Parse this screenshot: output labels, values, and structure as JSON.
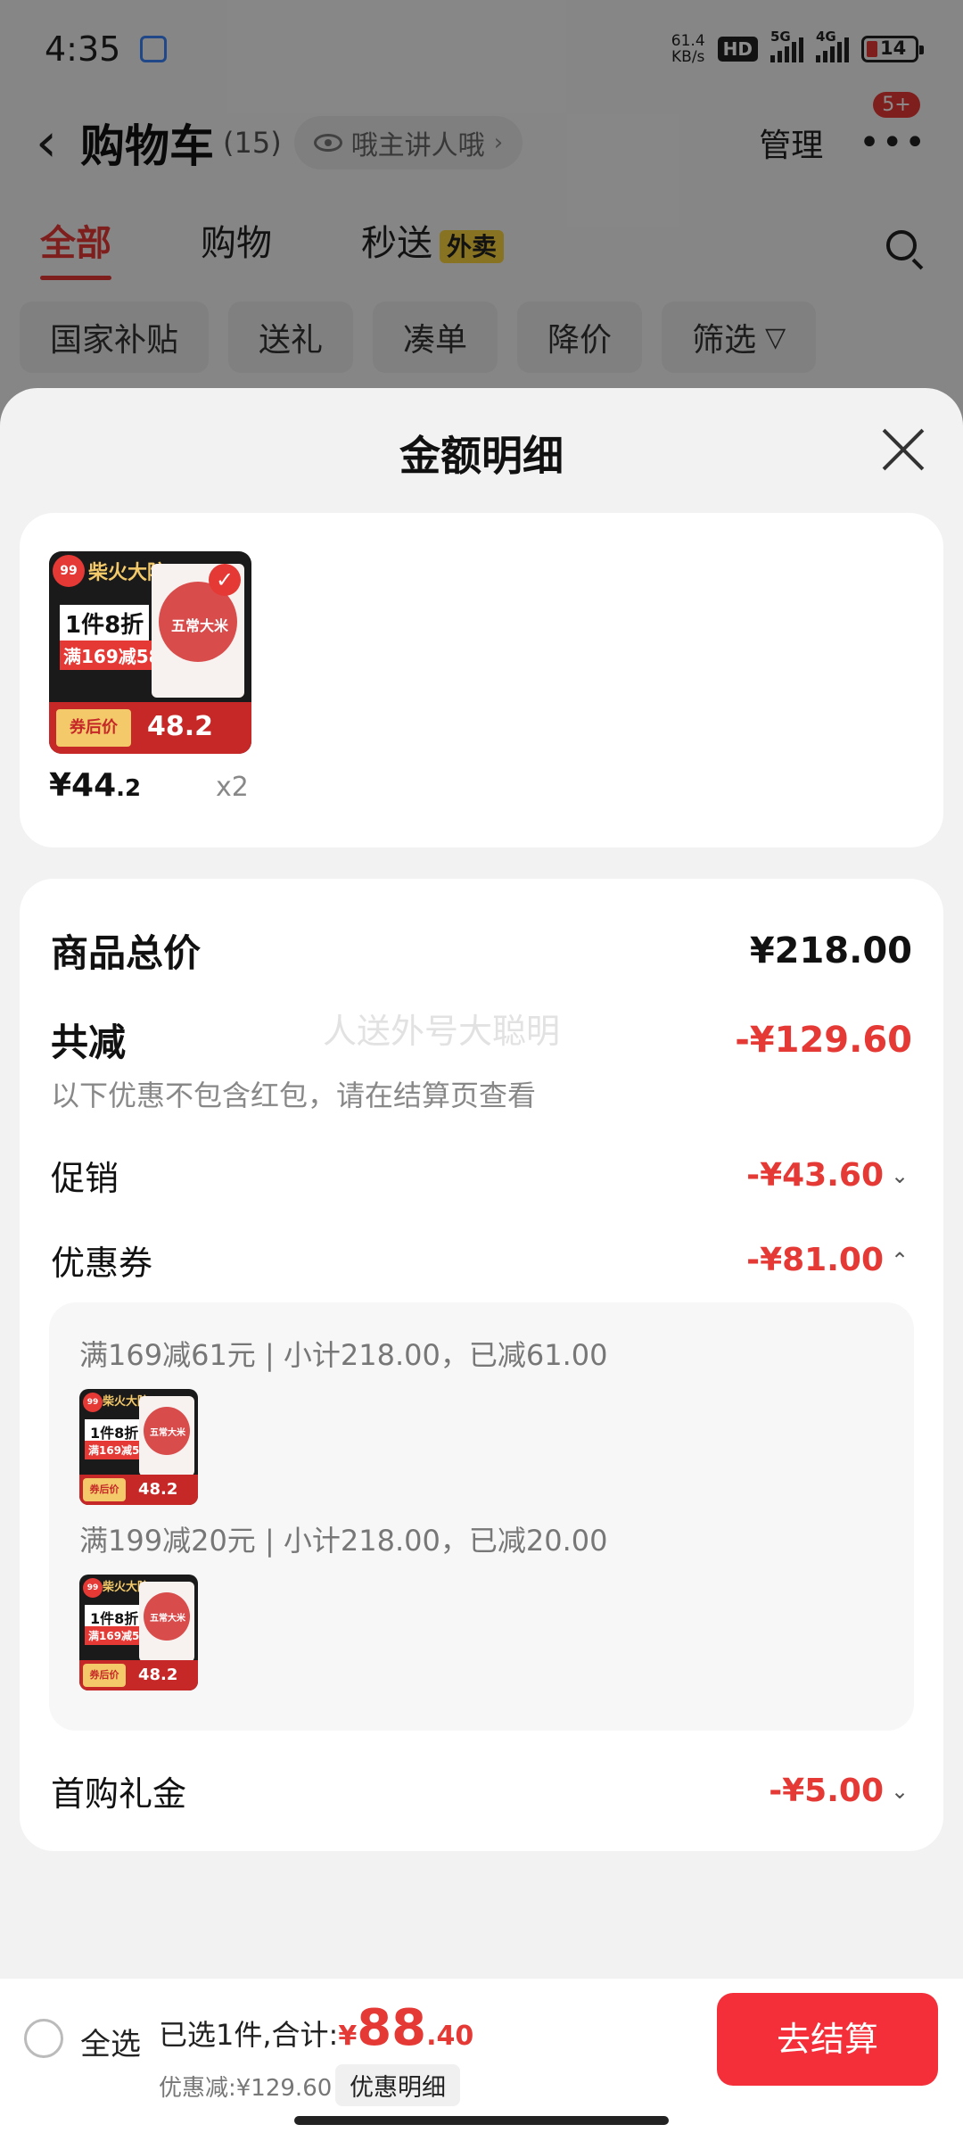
{
  "status_bar": {
    "time": "4:35",
    "net_speed_value": "61.4",
    "net_speed_unit": "KB/s",
    "hd_badge": "HD",
    "signal1_label": "5G",
    "signal2_label": "4G",
    "battery": "14"
  },
  "header": {
    "back_icon": "back-chevron-icon",
    "title": "购物车",
    "count": "(15)",
    "visibility_text": "哦主讲人哦",
    "manage": "管理",
    "more_badge": "5+"
  },
  "tabs": [
    {
      "label": "全部",
      "active": true
    },
    {
      "label": "购物",
      "active": false
    },
    {
      "label": "秒送",
      "active": false,
      "badge": "外卖"
    }
  ],
  "filter_chips": [
    "国家补贴",
    "送礼",
    "凑单",
    "降价",
    "筛选"
  ],
  "sheet": {
    "title": "金额明细",
    "product": {
      "thumb_brand": "柴火大院",
      "thumb_discount": "1件8折",
      "thumb_promo": "满169减58",
      "thumb_price_label": "券后价",
      "thumb_price_value": "48.2",
      "thumb_bag_text": "五常大米",
      "price_int": "¥44",
      "price_dec": ".2",
      "quantity": "x2"
    },
    "summary": {
      "total_label": "商品总价",
      "total_value": "¥218.00",
      "reduce_label": "共减",
      "reduce_value": "-¥129.60",
      "watermark": "人送外号大聪明",
      "note": "以下优惠不包含红包，请在结算页查看",
      "promo_label": "促销",
      "promo_value": "-¥43.60",
      "coupon_label": "优惠券",
      "coupon_value": "-¥81.00",
      "coupon_lines": [
        "满169减61元 | 小计218.00，已减61.00",
        "满199减20元 | 小计218.00，已减20.00"
      ],
      "gift_label": "首购礼金",
      "gift_value": "-¥5.00"
    }
  },
  "footer": {
    "select_all": "全选",
    "selected_text": "已选1件,合计:",
    "yen": "¥",
    "total_int": "88",
    "total_dec": ".40",
    "saved_text": "优惠减:¥129.60",
    "detail_button": "优惠明细",
    "checkout_button": "去结算"
  },
  "colors": {
    "accent_red": "#e53935",
    "checkout_red": "#f42f3a",
    "badge_yellow": "#f7d23e"
  }
}
